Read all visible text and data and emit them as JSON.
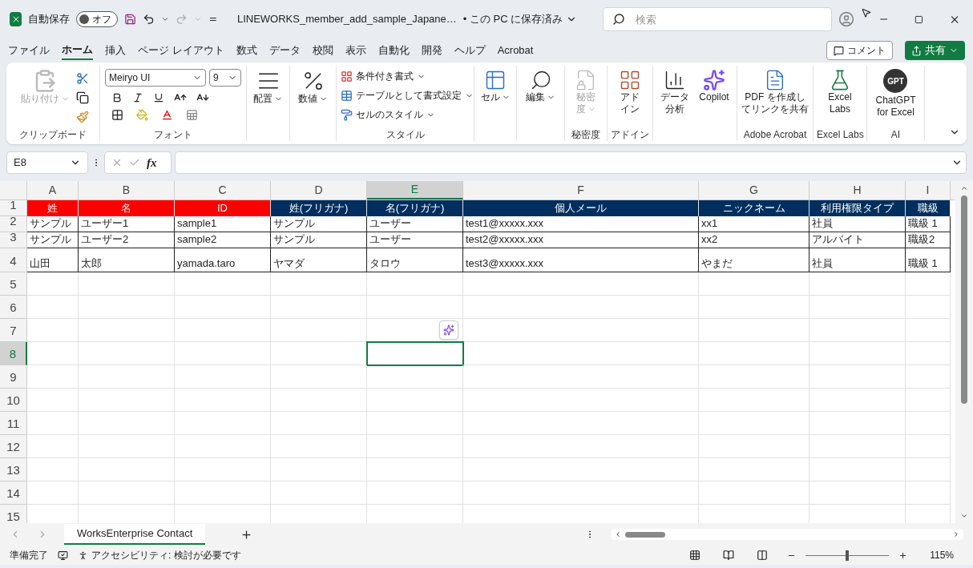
{
  "title_bar": {
    "autosave_label": "自動保存",
    "autosave_toggle": {
      "label": "オフ",
      "on": false
    },
    "file_name": "LINEWORKS_member_add_sample_Japane…",
    "save_status": "• この PC に保存済み",
    "search": {
      "placeholder": "検索"
    }
  },
  "menu_tabs": [
    {
      "label": "ファイル",
      "selected": false
    },
    {
      "label": "ホーム",
      "selected": true
    },
    {
      "label": "挿入",
      "selected": false
    },
    {
      "label": "ページ レイアウト",
      "selected": false
    },
    {
      "label": "数式",
      "selected": false
    },
    {
      "label": "データ",
      "selected": false
    },
    {
      "label": "校閲",
      "selected": false
    },
    {
      "label": "表示",
      "selected": false
    },
    {
      "label": "自動化",
      "selected": false
    },
    {
      "label": "開発",
      "selected": false
    },
    {
      "label": "ヘルプ",
      "selected": false
    },
    {
      "label": "Acrobat",
      "selected": false
    }
  ],
  "comment_button": "コメント",
  "share_button": "共有",
  "ribbon": {
    "clipboard": {
      "paste": {
        "label": "貼り付け",
        "disabled": true
      },
      "label": "クリップボード"
    },
    "font": {
      "font_name": "Meiryo UI",
      "font_size": "9",
      "label": "フォント"
    },
    "alignment": {
      "button": "配置"
    },
    "number": {
      "button": "数値"
    },
    "styles": {
      "items": [
        "条件付き書式",
        "テーブルとして書式設定",
        "セルのスタイル"
      ],
      "label": "スタイル"
    },
    "cells": {
      "button": "セル"
    },
    "editing": {
      "button": "編集"
    },
    "sensitivity": {
      "button_lines": [
        "秘密",
        "度"
      ],
      "disabled": true,
      "label": "秘密度"
    },
    "addins": {
      "button_lines": [
        "アド",
        "イン"
      ],
      "label": "アドイン"
    },
    "analysis": {
      "buttons": [
        {
          "kind": "analyze",
          "lines": [
            "データ",
            "分析"
          ]
        },
        {
          "kind": "copilot",
          "lines": [
            "Copilot"
          ]
        }
      ]
    },
    "acrobat": {
      "button_lines": [
        "PDF を作成し",
        "てリンクを共有"
      ],
      "label": "Adobe Acrobat"
    },
    "excel_labs": {
      "button_lines": [
        "Excel",
        "Labs"
      ],
      "label": "Excel Labs"
    },
    "ai": {
      "logo_text": "GPT",
      "button_lines": [
        "ChatGPT",
        "for Excel"
      ],
      "label": "AI"
    }
  },
  "formula_bar": {
    "name_box": "E8",
    "fx": "fx"
  },
  "sheet": {
    "columns": [
      {
        "label": "A",
        "selected": false
      },
      {
        "label": "B",
        "selected": false
      },
      {
        "label": "C",
        "selected": false
      },
      {
        "label": "D",
        "selected": false
      },
      {
        "label": "E",
        "selected": true
      },
      {
        "label": "F",
        "selected": false
      },
      {
        "label": "G",
        "selected": false
      },
      {
        "label": "H",
        "selected": false
      },
      {
        "label": "I",
        "selected": false
      }
    ],
    "rows": [
      {
        "number": "1",
        "selected": false,
        "cells": [
          {
            "text": "姓",
            "color": "#ff0000"
          },
          {
            "text": "名",
            "color": "#ff0000"
          },
          {
            "text": "ID",
            "color": "#ff0000"
          },
          {
            "text": "姓(フリガナ)",
            "color": "#002f5f"
          },
          {
            "text": "名(フリガナ)",
            "color": "#002f5f"
          },
          {
            "text": "個人メール",
            "color": "#002f5f"
          },
          {
            "text": "ニックネーム",
            "color": "#002f5f"
          },
          {
            "text": "利用権限タイプ",
            "color": "#002f5f"
          },
          {
            "text": "職級",
            "color": "#002f5f"
          }
        ]
      },
      {
        "number": "2",
        "selected": false,
        "cells": [
          {
            "text": "サンプル"
          },
          {
            "text": "ユーザー1"
          },
          {
            "text": "sample1"
          },
          {
            "text": "サンプル"
          },
          {
            "text": "ユーザー"
          },
          {
            "text": "test1@xxxxx.xxx"
          },
          {
            "text": "xx1"
          },
          {
            "text": "社員"
          },
          {
            "text": "職級 1"
          }
        ]
      },
      {
        "number": "3",
        "selected": false,
        "cells": [
          {
            "text": "サンプル"
          },
          {
            "text": "ユーザー2"
          },
          {
            "text": "sample2"
          },
          {
            "text": "サンプル"
          },
          {
            "text": "ユーザー"
          },
          {
            "text": "test2@xxxxx.xxx"
          },
          {
            "text": "xx2"
          },
          {
            "text": "アルバイト"
          },
          {
            "text": "職級2"
          }
        ]
      },
      {
        "number": "4",
        "selected": false,
        "cells": [
          {
            "text": "山田"
          },
          {
            "text": "太郎"
          },
          {
            "text": "yamada.taro"
          },
          {
            "text": "ヤマダ"
          },
          {
            "text": "タロウ"
          },
          {
            "text": "test3@xxxxx.xxx"
          },
          {
            "text": "やまだ"
          },
          {
            "text": "社員"
          },
          {
            "text": "職級 1"
          }
        ]
      },
      {
        "number": "5",
        "selected": false
      },
      {
        "number": "6",
        "selected": false
      },
      {
        "number": "7",
        "selected": false
      },
      {
        "number": "8",
        "selected": true
      },
      {
        "number": "9",
        "selected": false
      },
      {
        "number": "10",
        "selected": false
      },
      {
        "number": "11",
        "selected": false
      },
      {
        "number": "12",
        "selected": false
      },
      {
        "number": "13",
        "selected": false
      },
      {
        "number": "14",
        "selected": false
      },
      {
        "number": "15",
        "selected": false
      }
    ]
  },
  "sheet_tabs": [
    {
      "label": "WorksEnterprise Contact",
      "selected": true
    }
  ],
  "status_bar": {
    "ready": "準備完了",
    "accessibility": "アクセシビリティ: 検討が必要です",
    "zoom": {
      "level": 0.5
    },
    "zoom_percent": "115%"
  }
}
